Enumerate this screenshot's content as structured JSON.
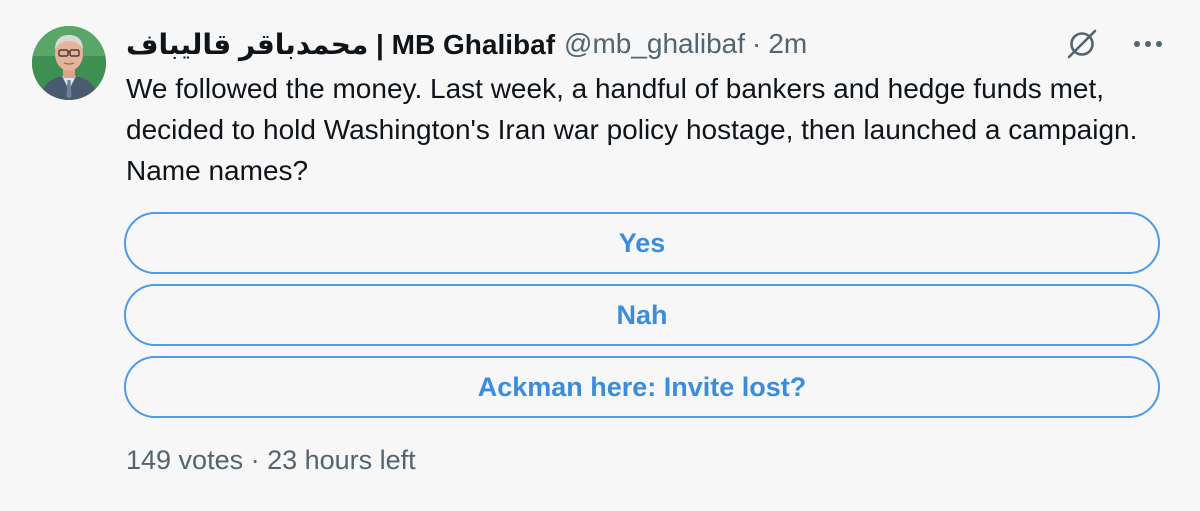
{
  "author": {
    "display_name": "محمدباقر قالیباف | MB Ghalibaf",
    "handle": "@mb_ghalibaf",
    "separator": "·",
    "time": "2m",
    "avatar_icon": "profile-photo"
  },
  "icons": {
    "action": "grok-icon",
    "more": "more-icon"
  },
  "tweet": {
    "text": "We followed the money. Last week, a handful of bankers and hedge funds met, decided to hold Washington's Iran war policy hostage, then launched a campaign. Name names?"
  },
  "poll": {
    "options": [
      {
        "label": "Yes"
      },
      {
        "label": "Nah"
      },
      {
        "label": "Ackman here: Invite lost?"
      }
    ],
    "meta": "149 votes · 23 hours left"
  },
  "colors": {
    "accent": "#4c9aea",
    "accent_text": "#3b8ddb",
    "secondary_text": "#536471",
    "background": "#f7f7f7"
  }
}
